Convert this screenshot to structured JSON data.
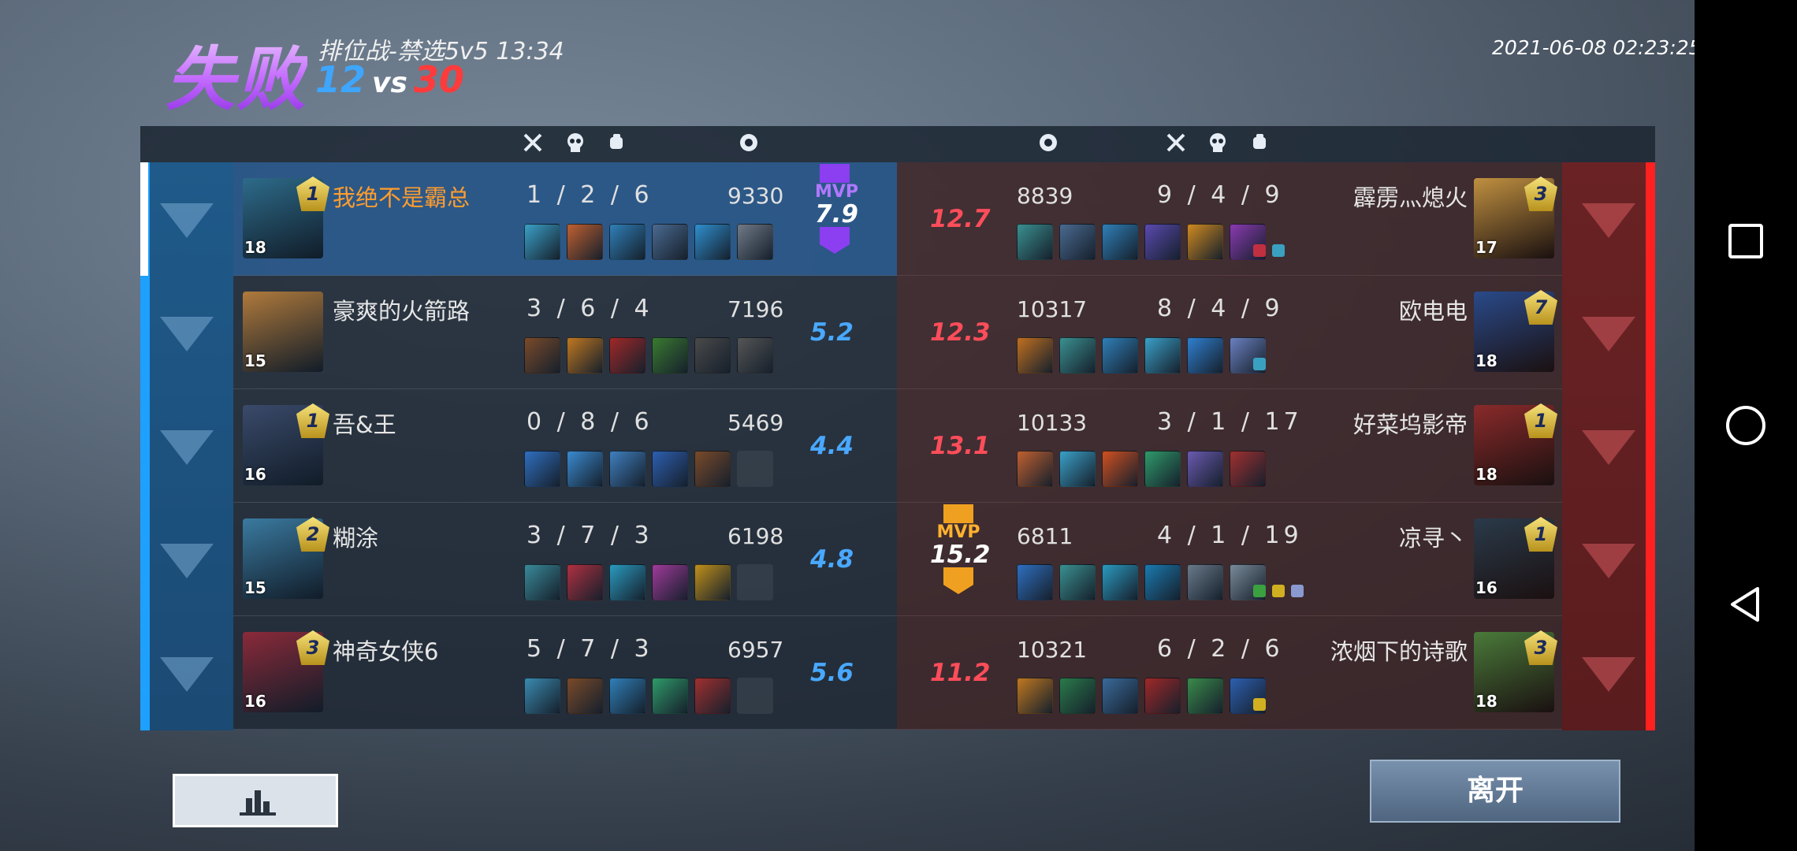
{
  "header": {
    "result": "失败",
    "mode": "排位战-禁选5v5 13:34",
    "score_blue": "12",
    "score_vs": "vs",
    "score_red": "30",
    "datetime": "2021-06-08 02:23:25"
  },
  "columns": {
    "kills_icon": "crossed-swords-icon",
    "deaths_icon": "skull-icon",
    "assists_icon": "fist-icon",
    "money_icon": "coin-icon"
  },
  "blue_team": [
    {
      "name": "我绝不是霸总",
      "level": "18",
      "rank": "1",
      "kda": "1 / 2 / 6",
      "money": "9330",
      "rating": "7.9",
      "mvp": true,
      "self": true,
      "portrait_color": "#2d6b8a",
      "items": [
        "#3aa0c8",
        "#c06030",
        "#2f7fb8",
        "#4a6a90",
        "#2f8fd0",
        "#707a88"
      ],
      "runes": []
    },
    {
      "name": "豪爽的火箭路",
      "level": "15",
      "rank": "",
      "kda": "3 / 6 / 4",
      "money": "7196",
      "rating": "5.2",
      "mvp": false,
      "self": false,
      "portrait_color": "#b07a3c",
      "items": [
        "#7a4a2a",
        "#c07820",
        "#a02828",
        "#3a7a30",
        "#4a4a4a",
        "#555555"
      ],
      "runes": []
    },
    {
      "name": "吾&王",
      "level": "16",
      "rank": "1",
      "kda": "0 / 8 / 6",
      "money": "5469",
      "rating": "4.4",
      "mvp": false,
      "self": false,
      "portrait_color": "#3a4a6a",
      "items": [
        "#2f6fc0",
        "#3a8ad0",
        "#3f7fbf",
        "#2d5fb0",
        "#7a4a2a",
        ""
      ],
      "runes": []
    },
    {
      "name": "糊涂",
      "level": "15",
      "rank": "2",
      "kda": "3 / 7 / 3",
      "money": "6198",
      "rating": "4.8",
      "mvp": false,
      "self": false,
      "portrait_color": "#3a7aa0",
      "items": [
        "#3a8a9a",
        "#b03040",
        "#2a9ac0",
        "#a03a9a",
        "#c0901a",
        ""
      ],
      "runes": []
    },
    {
      "name": "神奇女侠6",
      "level": "16",
      "rank": "3",
      "kda": "5 / 7 / 3",
      "money": "6957",
      "rating": "5.6",
      "mvp": false,
      "self": false,
      "portrait_color": "#8a2a3a",
      "items": [
        "#3a8ab0",
        "#7a4a2a",
        "#2f7fb8",
        "#2f9a6a",
        "#a03030",
        ""
      ],
      "runes": []
    }
  ],
  "red_team": [
    {
      "name": "霹雳灬熄火",
      "level": "17",
      "rank": "3",
      "kda": "9 / 4 / 9",
      "money": "8839",
      "rating": "12.7",
      "mvp": false,
      "portrait_color": "#c09040",
      "items": [
        "#3a9090",
        "#4a6a90",
        "#2f7fb8",
        "#5a4ab0",
        "#d08a20",
        "#8a3ab0"
      ],
      "runes": [
        "#c03040",
        "#3aa0c0"
      ]
    },
    {
      "name": "欧电电",
      "level": "18",
      "rank": "7",
      "kda": "8 / 4 / 9",
      "money": "10317",
      "rating": "12.3",
      "mvp": false,
      "portrait_color": "#2a4a8a",
      "items": [
        "#c07020",
        "#3a9090",
        "#2f7fb8",
        "#3aa0c8",
        "#2f7fd0",
        "#6a80c0"
      ],
      "runes": [
        "#3aa0c0"
      ]
    },
    {
      "name": "好菜坞影帝",
      "level": "18",
      "rank": "1",
      "kda": "3 / 1 / 17",
      "money": "10133",
      "rating": "13.1",
      "mvp": false,
      "portrait_color": "#8a2a2a",
      "items": [
        "#c06030",
        "#3aa0c8",
        "#d05020",
        "#2f9a6a",
        "#6a5ab0",
        "#a03030"
      ],
      "runes": []
    },
    {
      "name": "凉寻丶",
      "level": "16",
      "rank": "1",
      "kda": "4 / 1 / 19",
      "money": "6811",
      "rating": "15.2",
      "mvp": true,
      "portrait_color": "#2a3a4a",
      "items": [
        "#2f6fc0",
        "#3a9090",
        "#2a9ac0",
        "#1a7ab0",
        "#6a7a8a",
        "#7a8a9a"
      ],
      "runes": [
        "#3aa040",
        "#d0b020",
        "#8a9ad0"
      ]
    },
    {
      "name": "浓烟下的诗歌",
      "level": "18",
      "rank": "3",
      "kda": "6 / 2 / 6",
      "money": "10321",
      "rating": "11.2",
      "mvp": false,
      "portrait_color": "#4a7a3a",
      "items": [
        "#c07820",
        "#2a7a4a",
        "#3a6a9a",
        "#a02828",
        "#3a8a4a",
        "#2d5fb0"
      ],
      "runes": [
        "#d0b020"
      ]
    }
  ],
  "mvp_label": "MVP",
  "buttons": {
    "stats_icon": "bar-chart-icon",
    "leave": "离开"
  }
}
